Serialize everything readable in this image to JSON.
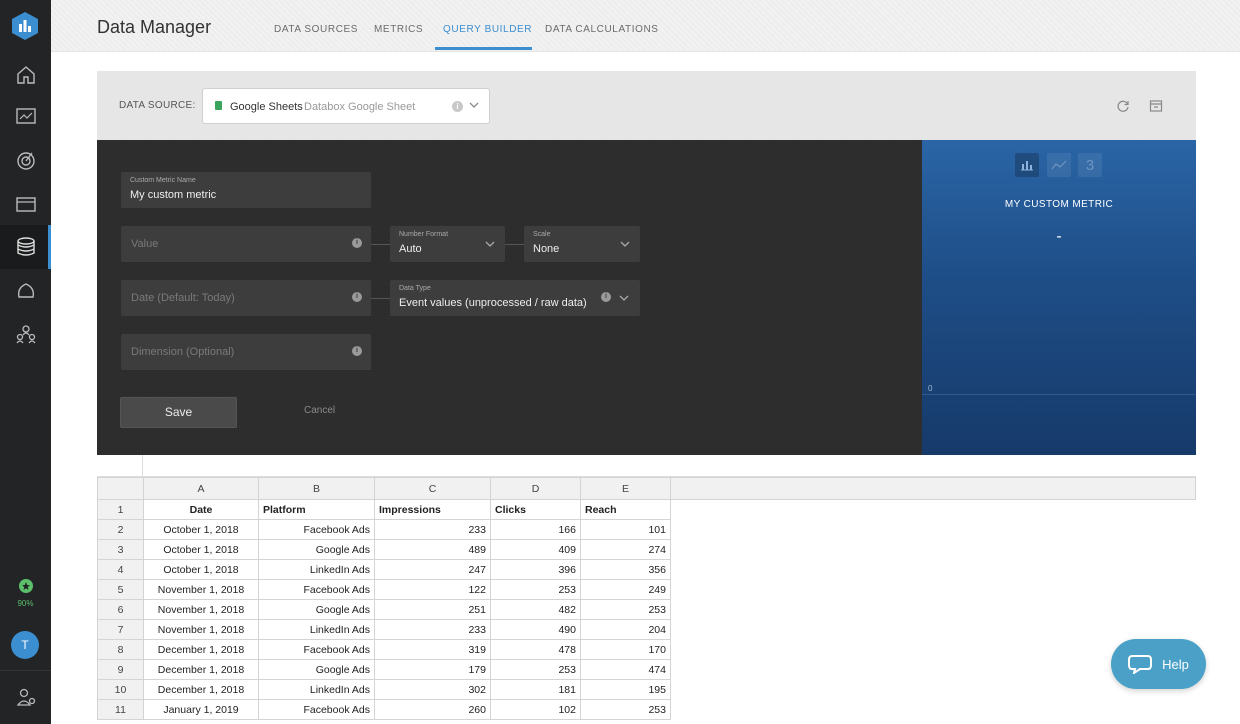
{
  "sidebar": {
    "logo_icon": "databox-logo-icon",
    "items": [
      {
        "name": "home",
        "icon": "home-icon"
      },
      {
        "name": "databoards",
        "icon": "dashboard-icon"
      },
      {
        "name": "goals",
        "icon": "target-icon"
      },
      {
        "name": "reports",
        "icon": "folder-icon"
      },
      {
        "name": "data-manager",
        "icon": "database-icon",
        "active": true
      },
      {
        "name": "alerts",
        "icon": "notification-icon"
      },
      {
        "name": "users",
        "icon": "people-icon"
      }
    ],
    "progress": "90%",
    "avatar_initial": "T"
  },
  "header": {
    "title": "Data Manager",
    "tabs": [
      {
        "label": "DATA SOURCES"
      },
      {
        "label": "METRICS"
      },
      {
        "label": "QUERY BUILDER",
        "active": true
      },
      {
        "label": "DATA CALCULATIONS"
      }
    ]
  },
  "datasource": {
    "label": "DATA SOURCE:",
    "name": "Google Sheets",
    "sub": "Databox Google Sheet"
  },
  "editor": {
    "metric_name_label": "Custom Metric Name",
    "metric_name_value": "My custom metric",
    "value_placeholder": "Value",
    "number_format_label": "Number Format",
    "number_format_value": "Auto",
    "scale_label": "Scale",
    "scale_value": "None",
    "date_placeholder": "Date (Default: Today)",
    "data_type_label": "Data Type",
    "data_type_value": "Event values (unprocessed / raw data)",
    "dimension_placeholder": "Dimension (Optional)",
    "save_label": "Save",
    "cancel_label": "Cancel"
  },
  "preview": {
    "viz_number_label": "3",
    "title": "MY CUSTOM METRIC",
    "value": "-",
    "axis_zero": "0"
  },
  "sheet": {
    "columns": [
      "A",
      "B",
      "C",
      "D",
      "E"
    ],
    "headers": [
      "Date",
      "Platform",
      "Impressions",
      "Clicks",
      "Reach"
    ],
    "rows": [
      {
        "n": "2",
        "date": "October 1, 2018",
        "platform": "Facebook Ads",
        "impressions": "233",
        "clicks": "166",
        "reach": "101"
      },
      {
        "n": "3",
        "date": "October 1, 2018",
        "platform": "Google Ads",
        "impressions": "489",
        "clicks": "409",
        "reach": "274"
      },
      {
        "n": "4",
        "date": "October 1, 2018",
        "platform": "LinkedIn Ads",
        "impressions": "247",
        "clicks": "396",
        "reach": "356"
      },
      {
        "n": "5",
        "date": "November 1, 2018",
        "platform": "Facebook Ads",
        "impressions": "122",
        "clicks": "253",
        "reach": "249"
      },
      {
        "n": "6",
        "date": "November 1, 2018",
        "platform": "Google Ads",
        "impressions": "251",
        "clicks": "482",
        "reach": "253"
      },
      {
        "n": "7",
        "date": "November 1, 2018",
        "platform": "LinkedIn Ads",
        "impressions": "233",
        "clicks": "490",
        "reach": "204"
      },
      {
        "n": "8",
        "date": "December 1, 2018",
        "platform": "Facebook Ads",
        "impressions": "319",
        "clicks": "478",
        "reach": "170"
      },
      {
        "n": "9",
        "date": "December 1, 2018",
        "platform": "Google Ads",
        "impressions": "179",
        "clicks": "253",
        "reach": "474"
      },
      {
        "n": "10",
        "date": "December 1, 2018",
        "platform": "LinkedIn Ads",
        "impressions": "302",
        "clicks": "181",
        "reach": "195"
      },
      {
        "n": "11",
        "date": "January 1, 2019",
        "platform": "Facebook Ads",
        "impressions": "260",
        "clicks": "102",
        "reach": "253"
      }
    ]
  },
  "help": {
    "label": "Help"
  }
}
